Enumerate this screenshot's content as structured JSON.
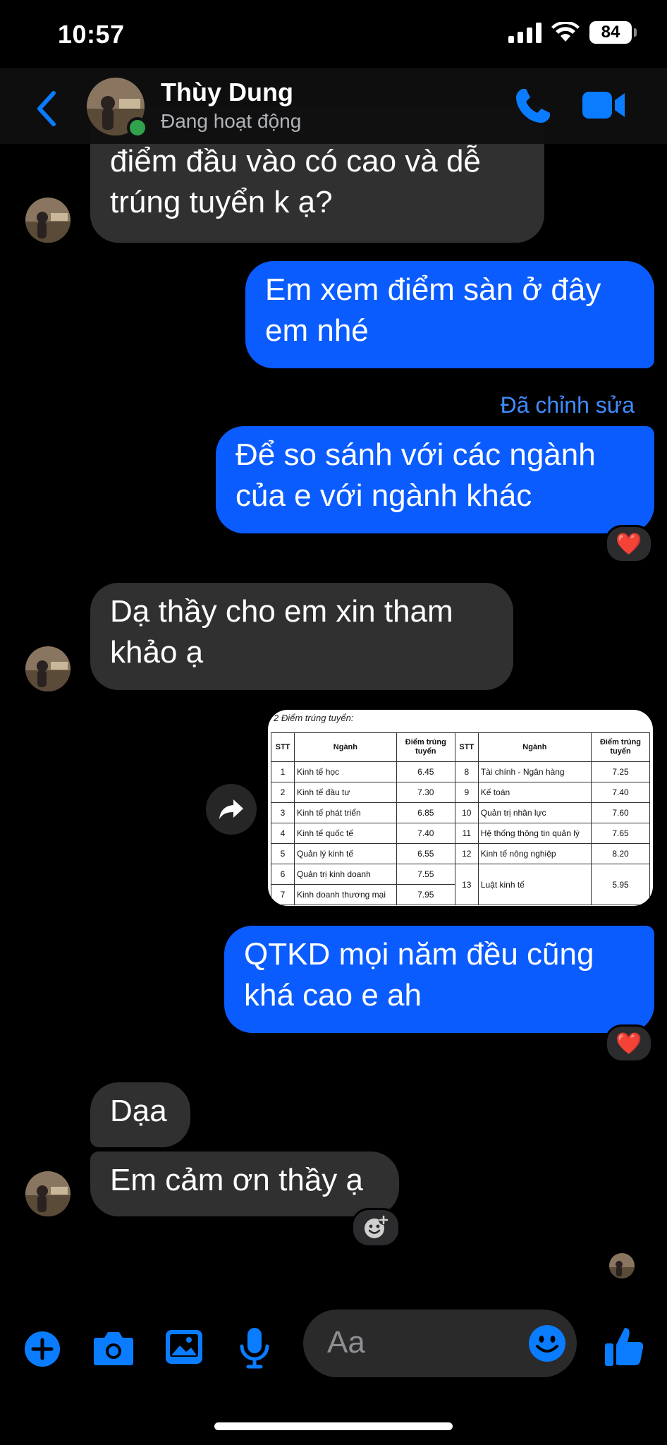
{
  "status_bar": {
    "time": "10:57",
    "battery": "84"
  },
  "header": {
    "contact_name": "Thùy Dung",
    "contact_status": "Đang hoạt động"
  },
  "messages": [
    {
      "direction": "in",
      "text_lines": [
        "điểm đầu vào có cao và dễ",
        "trúng tuyển k ạ?"
      ]
    },
    {
      "direction": "out",
      "text_lines": [
        "Em xem điểm sàn ở đây",
        "em nhé"
      ]
    },
    {
      "direction": "out",
      "edited_label": "Đã chỉnh sửa",
      "text_lines": [
        "Để so sánh với các ngành",
        "của e với ngành khác"
      ],
      "reaction": "❤️"
    },
    {
      "direction": "in",
      "text_lines": [
        "Dạ thầy cho em xin tham",
        "khảo ạ"
      ]
    },
    {
      "direction": "out",
      "type": "image"
    },
    {
      "direction": "out",
      "text_lines": [
        "QTKD mọi năm đều cũng",
        "khá cao e ah"
      ],
      "reaction": "❤️"
    },
    {
      "direction": "in",
      "text_lines": [
        "Dạa"
      ]
    },
    {
      "direction": "in",
      "text_lines": [
        "Em cảm ơn thầy ạ"
      ]
    }
  ],
  "shared_table": {
    "caption": "2 Điểm trúng tuyển:",
    "headers": [
      "STT",
      "Ngành",
      "Điểm trúng tuyển",
      "STT",
      "Ngành",
      "Điểm trúng tuyển"
    ],
    "rows": [
      [
        "1",
        "Kinh tế học",
        "6.45",
        "8",
        "Tài chính - Ngân hàng",
        "7.25"
      ],
      [
        "2",
        "Kinh tế đầu tư",
        "7.30",
        "9",
        "Kế toán",
        "7.40"
      ],
      [
        "3",
        "Kinh tế phát triển",
        "6.85",
        "10",
        "Quản trị nhân lực",
        "7.60"
      ],
      [
        "4",
        "Kinh tế quốc tế",
        "7.40",
        "11",
        "Hệ thống thông tin quản lý",
        "7.65"
      ],
      [
        "5",
        "Quản lý kinh tế",
        "6.55",
        "12",
        "Kinh tế nông nghiệp",
        "8.20"
      ],
      [
        "6",
        "Quản trị kinh doanh",
        "7.55",
        "13",
        "Luật kinh tế",
        "5.95"
      ],
      [
        "7",
        "Kinh doanh thương mại",
        "7.95"
      ]
    ]
  },
  "composer": {
    "placeholder": "Aa"
  },
  "colors": {
    "accent": "#0a5cff",
    "incoming_bubble": "#303030",
    "background": "#000000",
    "online": "#31a24c"
  },
  "icons": [
    "back-chevron-icon",
    "phone-icon",
    "video-camera-icon",
    "share-icon",
    "add-reaction-icon",
    "plus-icon",
    "camera-icon",
    "gallery-icon",
    "microphone-icon",
    "emoji-icon",
    "thumbs-up-icon"
  ]
}
